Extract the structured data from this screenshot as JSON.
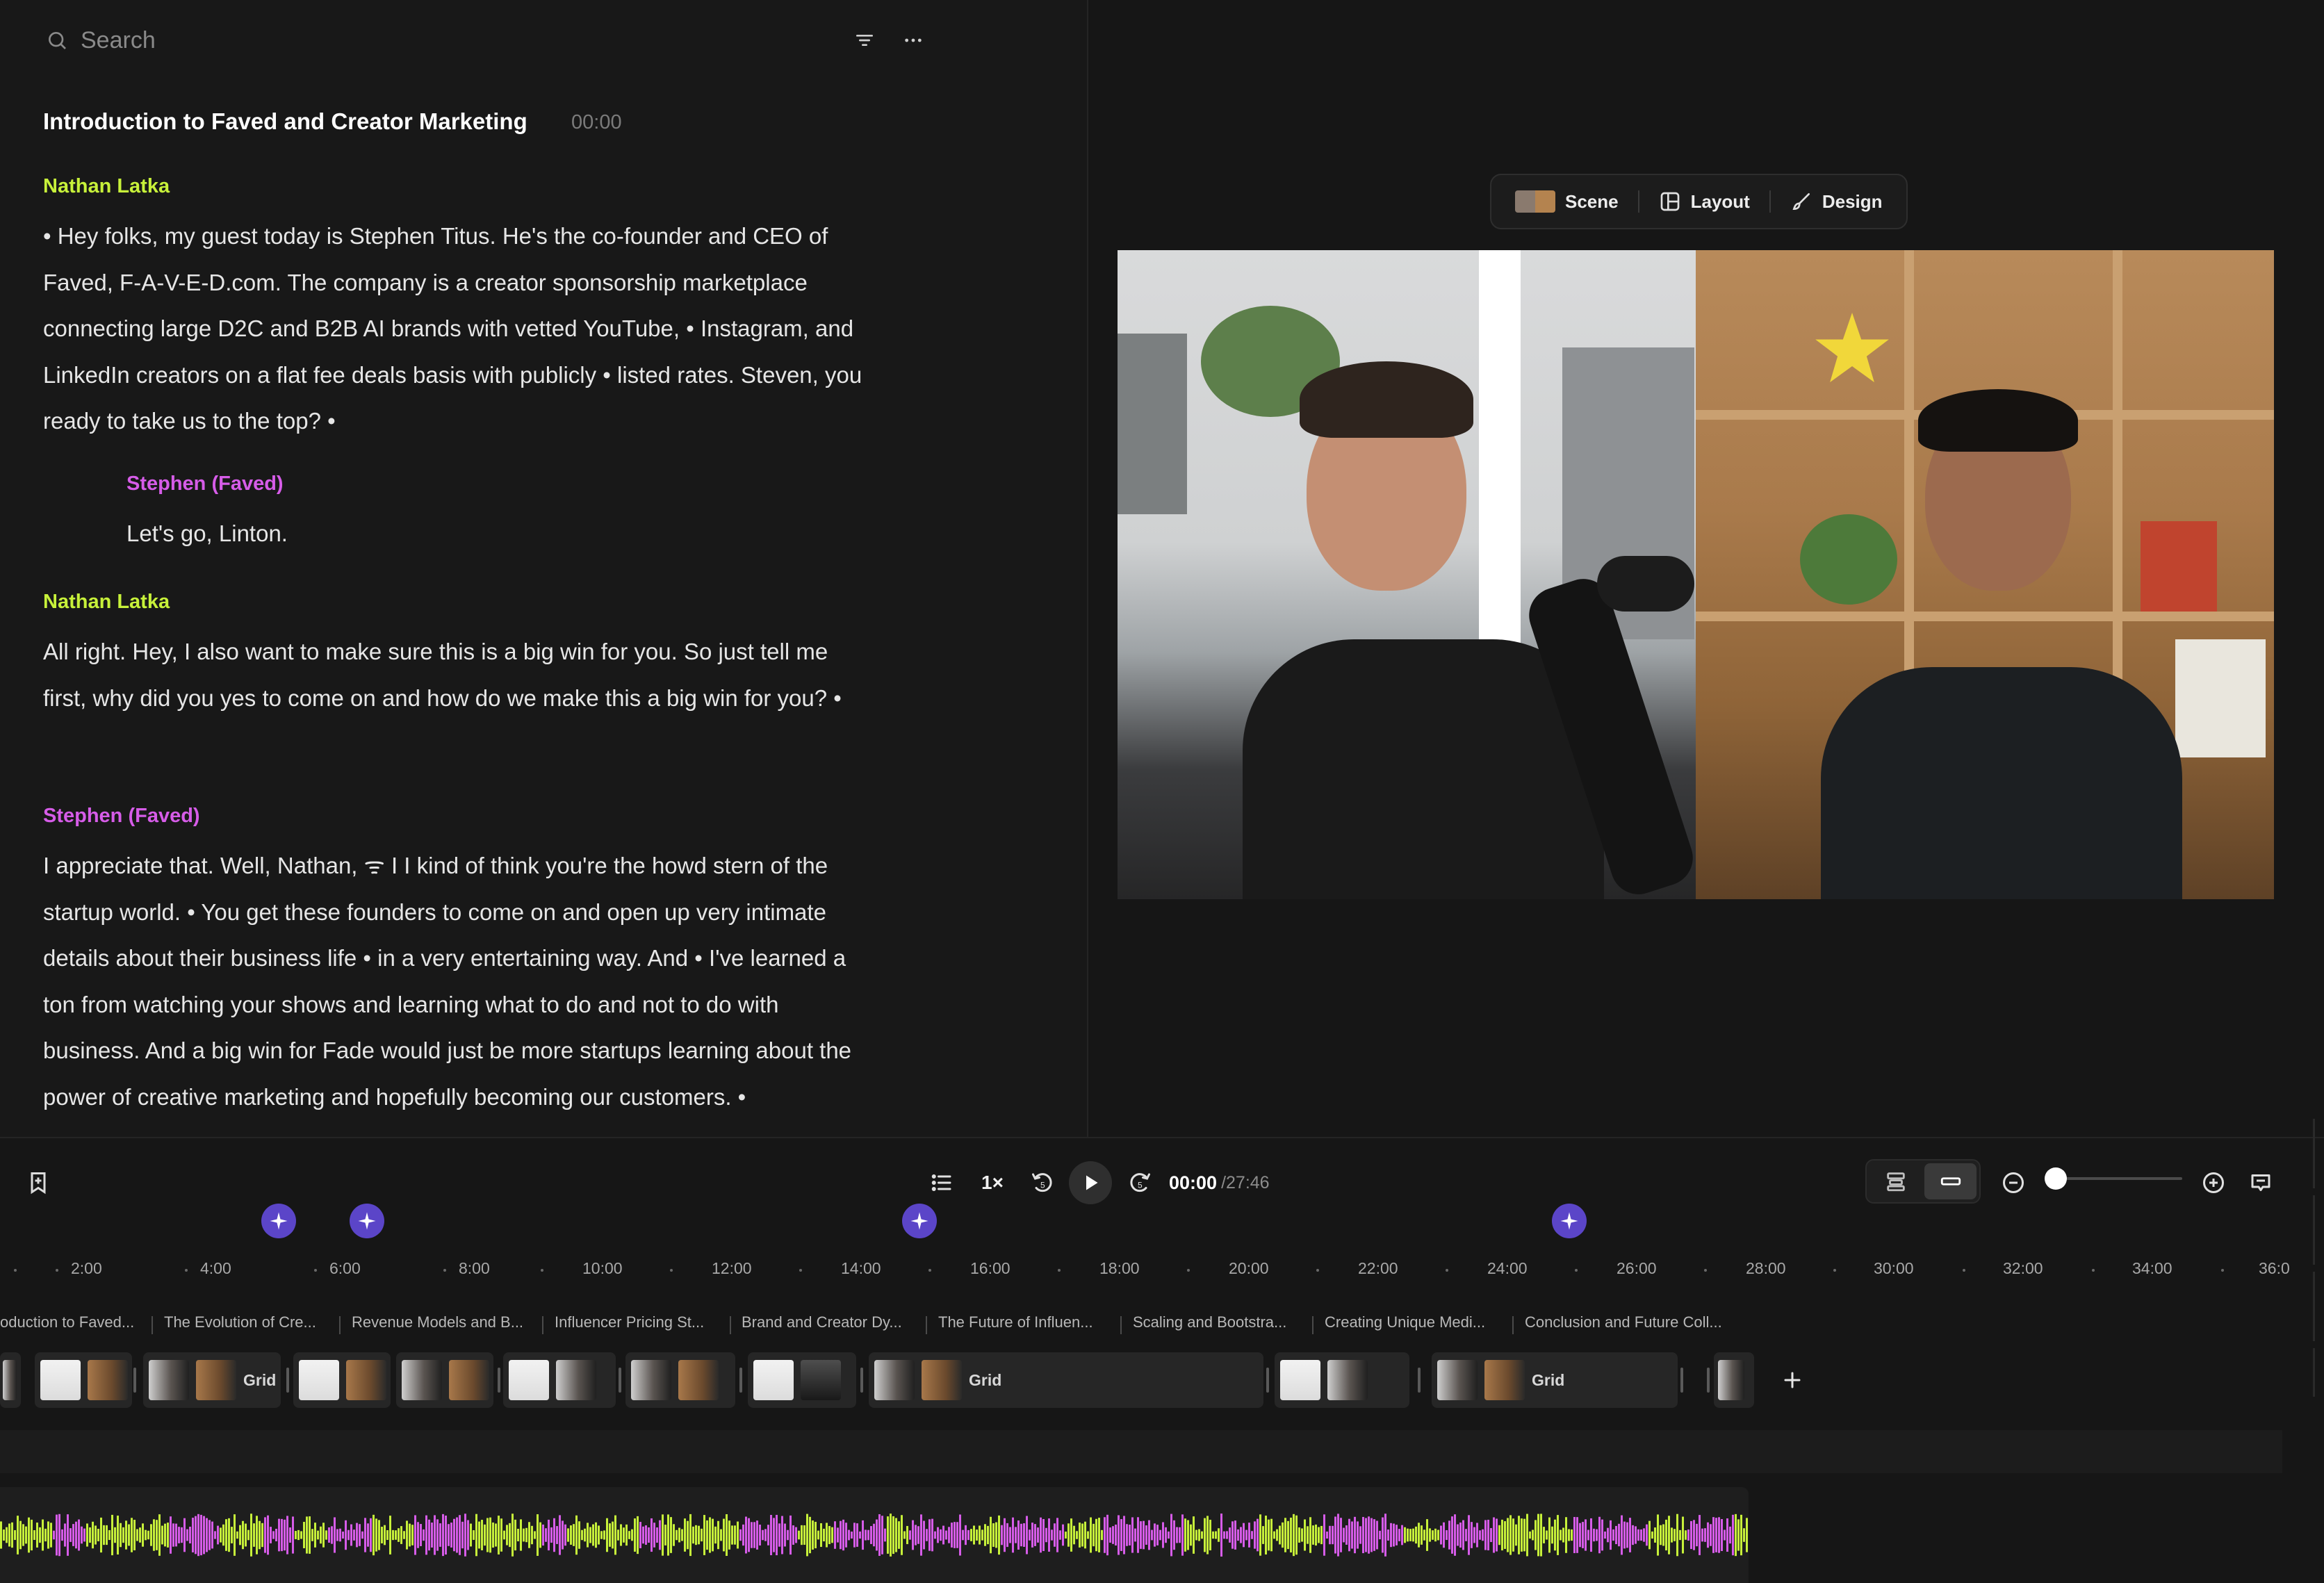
{
  "search": {
    "placeholder": "Search"
  },
  "transcript": {
    "chapter_title": "Introduction to Faved and Creator Marketing",
    "chapter_time": "00:00",
    "blocks": [
      {
        "speaker": "Nathan Latka",
        "text": "• Hey folks, my guest today is Stephen Titus. He's the co-founder and CEO of Faved, F-A-V-E-D.com. The company is a creator sponsorship marketplace connecting large D2C and B2B AI brands with vetted YouTube, • Instagram, and LinkedIn creators on a flat fee deals basis with publicly • listed rates. Steven, you ready to take us to the top? •"
      },
      {
        "speaker": "Stephen (Faved)",
        "text": "Let's go, Linton."
      },
      {
        "speaker": "Nathan Latka",
        "text": "All right. Hey, I also want to make sure this is a big win for you. So just tell me first, why did you yes to come on and how do we make this a big win for you? •"
      },
      {
        "speaker": "Stephen (Faved)",
        "text": "I appreciate that. Well, Nathan, ᯤ I I kind of think you're the howd stern of the startup world. • You get these founders to come on and open up very intimate details about their business life • in a very entertaining way. And • I've learned a ton from watching your shows and learning what to do and not to do with business. And a big win for Fade would just be more startups learning about the power of creative marketing and hopefully becoming our customers. •"
      }
    ]
  },
  "preview": {
    "toolbar": {
      "scene": "Scene",
      "layout": "Layout",
      "design": "Design"
    }
  },
  "player": {
    "speed": "1×",
    "current_time": "00:00",
    "total_time": "/27:46",
    "zoom_level": 0.0
  },
  "timeline": {
    "ruler": [
      "2:00",
      "4:00",
      "6:00",
      "8:00",
      "10:00",
      "12:00",
      "14:00",
      "16:00",
      "18:00",
      "20:00",
      "22:00",
      "24:00",
      "26:00",
      "28:00",
      "30:00",
      "32:00",
      "34:00",
      "36:0"
    ],
    "chapters": [
      "oduction to Faved...",
      "The Evolution of Cre...",
      "Revenue Models and B...",
      "Influencer Pricing St...",
      "Brand and Creator Dy...",
      "The Future of Influen...",
      "Scaling and Bootstra...",
      "Creating Unique Medi...",
      "Conclusion and Future Coll..."
    ],
    "clip_label": "Grid"
  },
  "colors": {
    "nathan": "#c7f13a",
    "stephen": "#d65ce8",
    "marker": "#5b45c8"
  }
}
